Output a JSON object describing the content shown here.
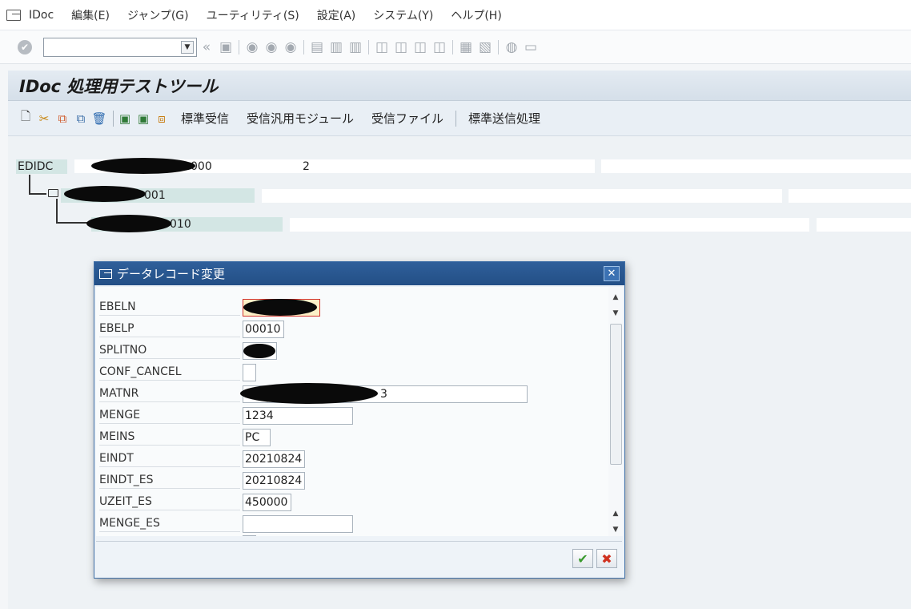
{
  "menu": {
    "items": [
      "IDoc",
      "編集(E)",
      "ジャンプ(G)",
      "ユーティリティ(S)",
      "設定(A)",
      "システム(Y)",
      "ヘルプ(H)"
    ]
  },
  "toolbar": {
    "command_value": "",
    "back_glyph": "«"
  },
  "title": "IDoc 処理用テストツール",
  "app_toolbar": {
    "buttons": [
      "標準受信",
      "受信汎用モジュール",
      "受信ファイル",
      "標準送信処理"
    ]
  },
  "tree": {
    "root_label": "EDIDC",
    "root_number_tail": "000",
    "root_count": "2",
    "child1_tail": "001",
    "child2_tail": "010"
  },
  "dialog": {
    "title": "データレコード変更",
    "close_glyph": "✕",
    "fields": [
      {
        "label": "EBELN",
        "value": ""
      },
      {
        "label": "EBELP",
        "value": "00010"
      },
      {
        "label": "SPLITNO",
        "value": ""
      },
      {
        "label": "CONF_CANCEL",
        "value": ""
      },
      {
        "label": "MATNR",
        "value": "3"
      },
      {
        "label": "MENGE",
        "value": "1234"
      },
      {
        "label": "MEINS",
        "value": "PC"
      },
      {
        "label": "EINDT",
        "value": "20210824"
      },
      {
        "label": "EINDT_ES",
        "value": "20210824"
      },
      {
        "label": "UZEIT_ES",
        "value": "450000"
      },
      {
        "label": "MENGE_ES",
        "value": ""
      }
    ],
    "ok_glyph": "✔",
    "cancel_glyph": "✖"
  }
}
